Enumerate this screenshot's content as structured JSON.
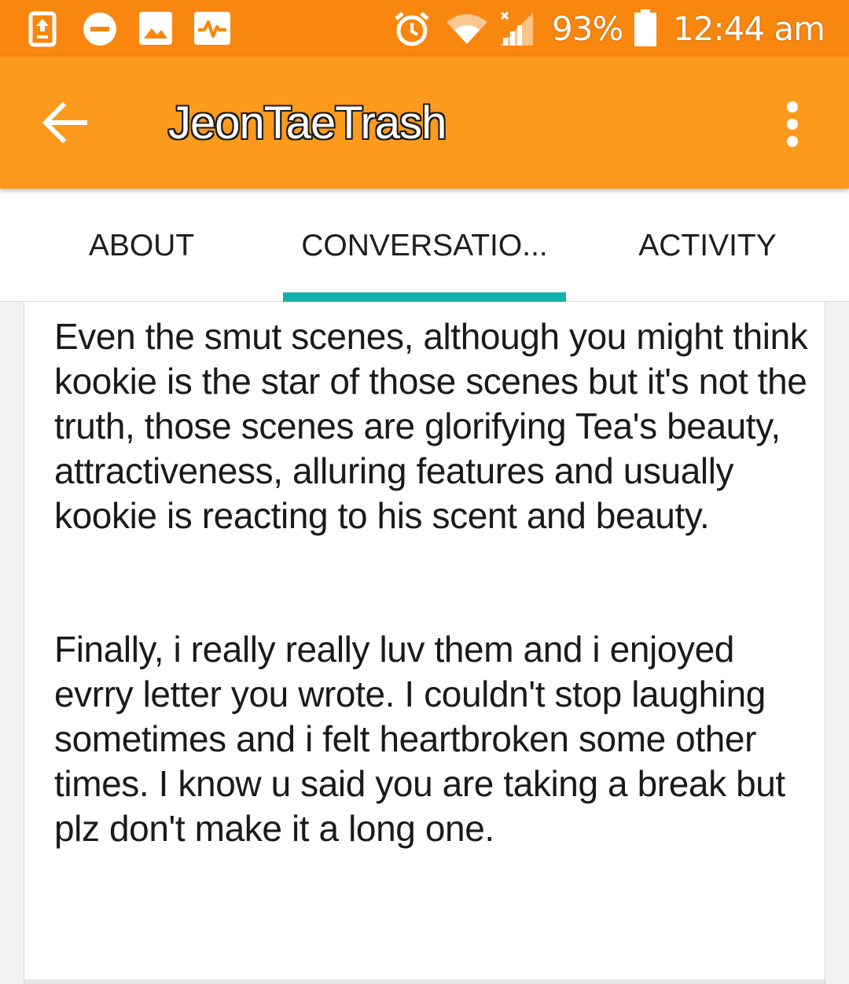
{
  "status_bar": {
    "battery_percent": "93%",
    "time": "12:44 am",
    "icons": [
      "upload-icon",
      "do-not-disturb-icon",
      "image-icon",
      "activity-icon",
      "alarm-icon",
      "wifi-icon",
      "signal-icon",
      "battery-icon"
    ],
    "background": "#f9860e"
  },
  "app_bar": {
    "title": "JeonTaeTrash",
    "back_icon": "arrow-back-icon",
    "menu_icon": "more-vert-icon",
    "background": "#fb9a1c"
  },
  "tabs": [
    {
      "label": "ABOUT",
      "selected": false
    },
    {
      "label": "CONVERSATIO...",
      "selected": true
    },
    {
      "label": "ACTIVITY",
      "selected": false
    }
  ],
  "accent_color": "#14b1ab",
  "message": {
    "paragraphs": [
      "Even the smut scenes, although you might think kookie is the star of those scenes but it's not the truth, those scenes are glorifying Tea's beauty, attractiveness, alluring features and usually kookie is reacting to his scent and beauty.",
      "Finally, i really really luv them and i enjoyed evrry letter you wrote. I couldn't stop laugh­ing sometimes and i felt heartbroken some other times. I know u said you are taking a break but plz don't make it a long one."
    ]
  }
}
